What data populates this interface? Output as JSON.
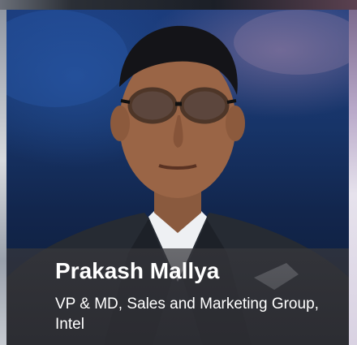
{
  "card": {
    "name": "Prakash Mallya",
    "title": "VP & MD, Sales and Marketing Group, Intel"
  },
  "photo": {
    "subject": "portrait-photo"
  },
  "colors": {
    "background": "#12264d",
    "caption_overlay": "#37373c",
    "caption_text": "#ffffff"
  }
}
